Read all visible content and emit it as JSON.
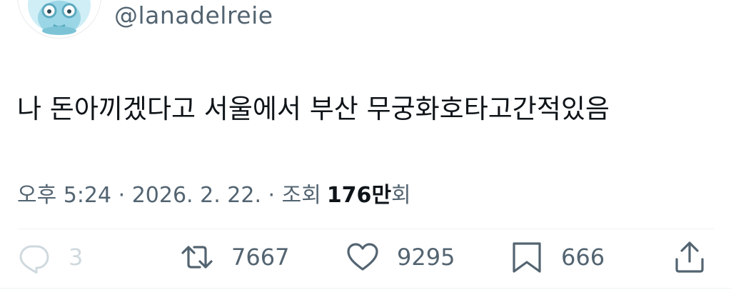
{
  "author": {
    "handle": "@lanadelreie",
    "avatar_icon": "avatar-cartoon-icon"
  },
  "tweet": {
    "text": "나 돈아끼겠다고 서울에서 부산 무궁화호타고간적있음"
  },
  "meta": {
    "time_date": "오후 5:24 · 2026. 2. 22. · 조회",
    "views_number": "176",
    "views_unit": "만",
    "views_suffix": "회"
  },
  "actions": {
    "reply_count": "3",
    "retweet_count": "7667",
    "like_count": "9295",
    "bookmark_count": "666"
  },
  "colors": {
    "text_primary": "#0f1419",
    "text_secondary": "#536471",
    "reply_faded": "#cfd9de",
    "divider": "#eff3f4"
  }
}
